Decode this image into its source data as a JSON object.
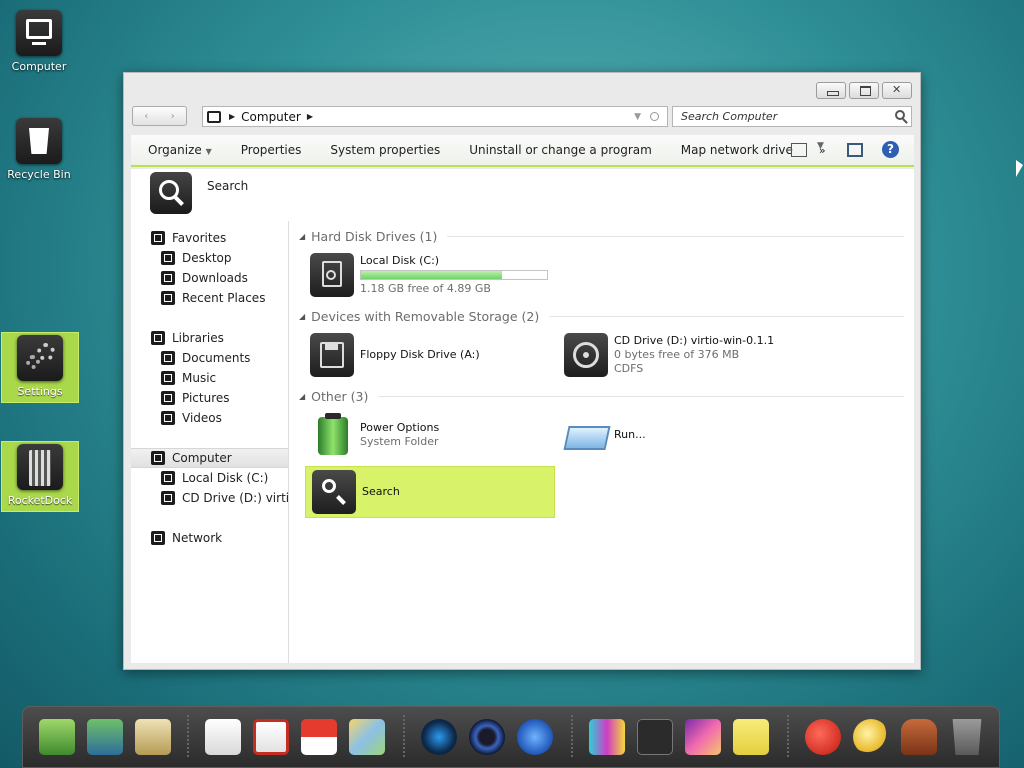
{
  "desktop": {
    "icons": [
      {
        "label": "Computer"
      },
      {
        "label": "Recycle Bin"
      },
      {
        "label": "Settings"
      },
      {
        "label": "RocketDock"
      }
    ]
  },
  "window": {
    "address": {
      "crumb": "Computer"
    },
    "search": {
      "placeholder": "Search Computer"
    },
    "commands": [
      "Organize",
      "Properties",
      "System properties",
      "Uninstall or change a program",
      "Map network drive",
      "»"
    ],
    "header_label": "Search",
    "nav": {
      "favorites": "Favorites",
      "desktop": "Desktop",
      "downloads": "Downloads",
      "recent": "Recent Places",
      "libraries": "Libraries",
      "documents": "Documents",
      "music": "Music",
      "pictures": "Pictures",
      "videos": "Videos",
      "computer": "Computer",
      "local_disk": "Local Disk (C:)",
      "cd_drive": "CD Drive (D:) virtio-w",
      "network": "Network"
    },
    "groups": {
      "hard_disks": "Hard Disk Drives (1)",
      "removable": "Devices with Removable Storage (2)",
      "other": "Other (3)"
    },
    "items": {
      "local_disk": {
        "name": "Local Disk (C:)",
        "free": "1.18 GB free of 4.89 GB",
        "used_fraction": 0.76
      },
      "floppy": {
        "name": "Floppy Disk Drive (A:)"
      },
      "cd": {
        "name": "CD Drive (D:) virtio-win-0.1.1",
        "free": "0 bytes free of 376 MB",
        "fs": "CDFS"
      },
      "power": {
        "name": "Power Options",
        "sub": "System Folder"
      },
      "run": {
        "name": "Run..."
      },
      "search": {
        "name": "Search"
      }
    }
  },
  "colors": {
    "accent": "#b8e04f",
    "selection": "#d8f26a"
  }
}
